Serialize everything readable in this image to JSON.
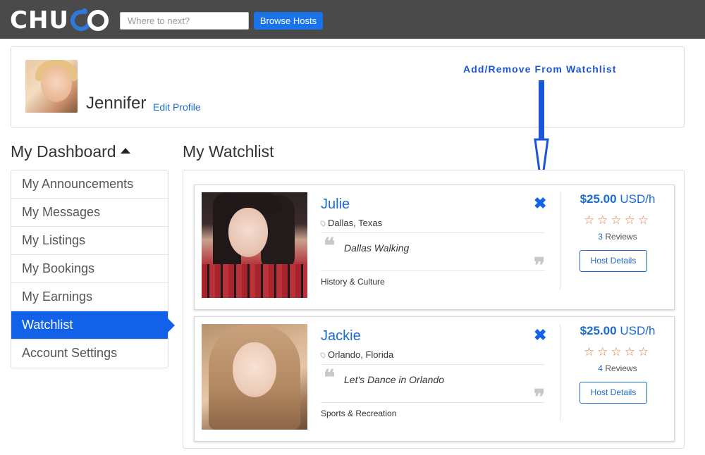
{
  "header": {
    "logo_text": "CHUKO",
    "search_placeholder": "Where to next?",
    "browse_label": "Browse Hosts"
  },
  "profile": {
    "name": "Jennifer",
    "edit_label": "Edit Profile",
    "callout": "Add/Remove From Watchlist"
  },
  "sidebar": {
    "title": "My Dashboard",
    "items": [
      {
        "label": "My Announcements",
        "active": false
      },
      {
        "label": "My Messages",
        "active": false
      },
      {
        "label": "My Listings",
        "active": false
      },
      {
        "label": "My Bookings",
        "active": false
      },
      {
        "label": "My Earnings",
        "active": false
      },
      {
        "label": "Watchlist",
        "active": true
      },
      {
        "label": "Account Settings",
        "active": false
      }
    ]
  },
  "watchlist": {
    "title": "My Watchlist",
    "hosts": [
      {
        "name": "Julie",
        "location": "Dallas, Texas",
        "tagline": "Dallas Walking",
        "category": "History & Culture",
        "price": "$25.00",
        "unit": "USD/h",
        "rating": 0,
        "stars": "☆☆☆☆☆",
        "review_count": "3",
        "review_label": "Reviews",
        "details_label": "Host Details"
      },
      {
        "name": "Jackie",
        "location": "Orlando, Florida",
        "tagline": "Let's Dance in Orlando",
        "category": "Sports & Recreation",
        "price": "$25.00",
        "unit": "USD/h",
        "rating": 0,
        "stars": "☆☆☆☆☆",
        "review_count": "4",
        "review_label": "Reviews",
        "details_label": "Host Details"
      }
    ]
  },
  "colors": {
    "topbar": "#4a4a4a",
    "accent": "#1162e8",
    "link": "#1a6bd1",
    "star": "#e07a3c",
    "callout": "#1a55d6"
  }
}
